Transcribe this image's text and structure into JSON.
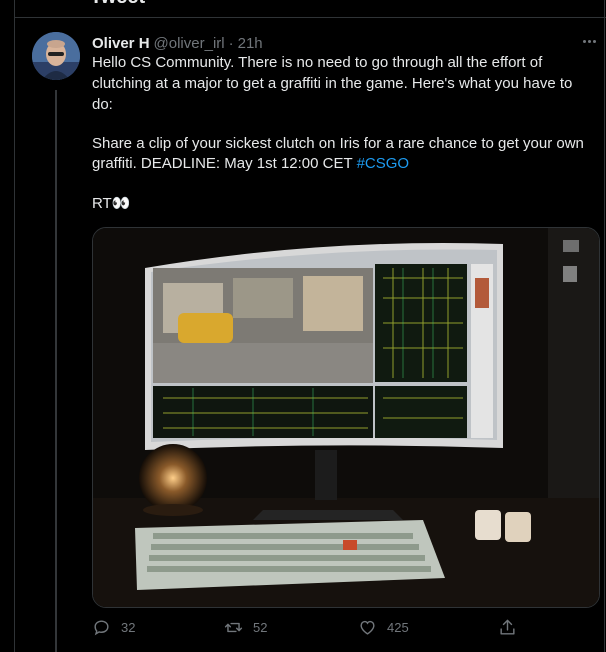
{
  "page": {
    "heading": "Tweet"
  },
  "tweet": {
    "author_name": "Oliver H",
    "author_handle": "@oliver_irl",
    "separator": "·",
    "time": "21h",
    "text_line1": "Hello CS Community. There is no need to go through all the effort of",
    "text_line2": "clutching at a major to get a graffiti in the game. Here's what you have to",
    "text_line3": "do:",
    "text_line4": "Share a clip of your sickest clutch on Iris for a rare chance to get your own",
    "text_line5_prefix": "graffiti. DEADLINE: May 1st 12:00 CET ",
    "hashtag": "#CSGO",
    "text_line6": "RT👀",
    "image_alt": "Photo of a desk with a curved monitor showing a map editor and a keyboard"
  },
  "actions": {
    "reply_count": "32",
    "retweet_count": "52",
    "like_count": "425"
  },
  "colors": {
    "background": "#000000",
    "text": "#e7e9ea",
    "secondary": "#71767b",
    "accent": "#1d9bf0"
  },
  "icons": [
    "more-icon",
    "reply-icon",
    "retweet-icon",
    "like-icon",
    "share-icon"
  ]
}
